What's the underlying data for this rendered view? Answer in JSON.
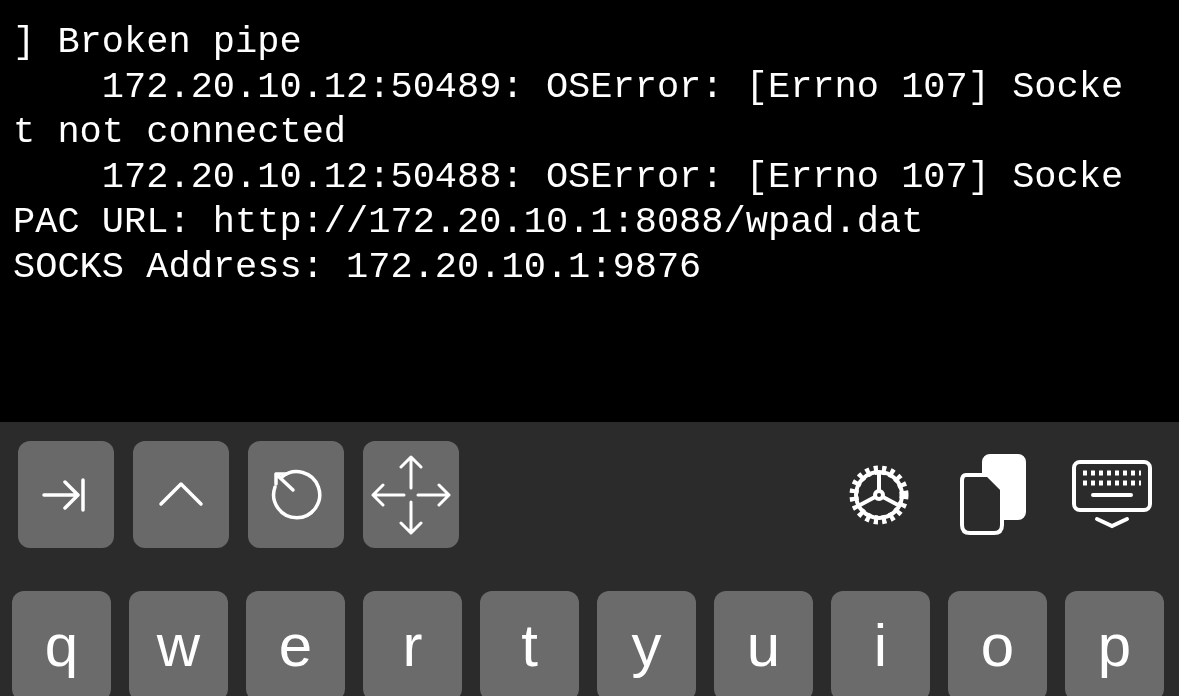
{
  "terminal": {
    "lines": [
      "] Broken pipe",
      "    172.20.10.12:50489: OSError: [Errno 107] Socke",
      "t not connected",
      "    172.20.10.12:50488: OSError: [Errno 107] Socke",
      "PAC URL: http://172.20.10.1:8088/wpad.dat",
      "SOCKS Address: 172.20.10.1:9876"
    ]
  },
  "keyboard": {
    "keys": [
      "q",
      "w",
      "e",
      "r",
      "t",
      "y",
      "u",
      "i",
      "o",
      "p"
    ]
  }
}
